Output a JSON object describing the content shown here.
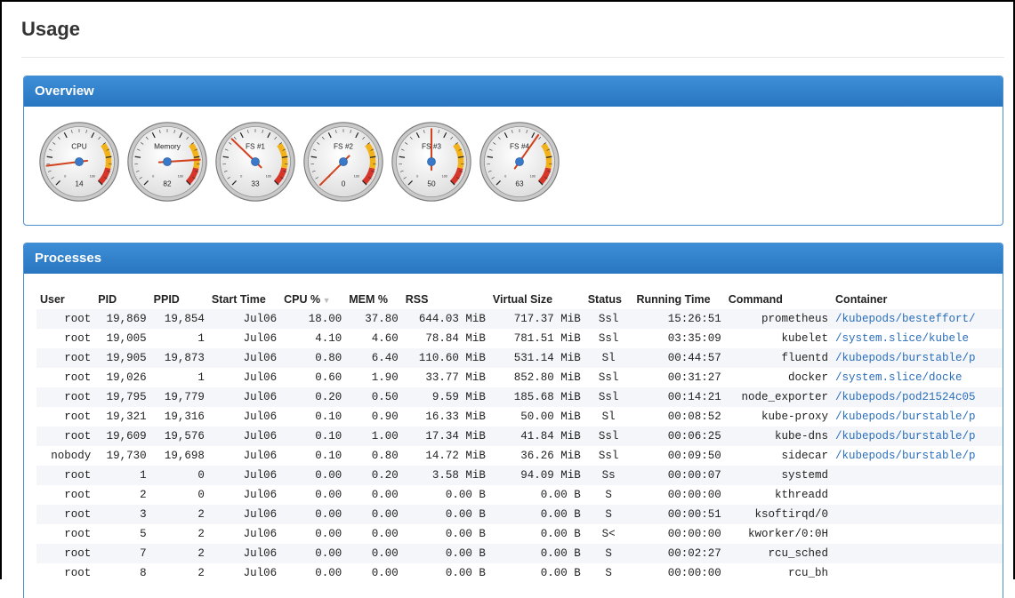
{
  "page": {
    "title": "Usage"
  },
  "overview": {
    "title": "Overview",
    "gauges": [
      {
        "label": "CPU",
        "value": 14
      },
      {
        "label": "Memory",
        "value": 82
      },
      {
        "label": "FS #1",
        "value": 33
      },
      {
        "label": "FS #2",
        "value": 0
      },
      {
        "label": "FS #3",
        "value": 50
      },
      {
        "label": "FS #4",
        "value": 63
      }
    ],
    "scale_min": "0",
    "scale_max": "100"
  },
  "processes": {
    "title": "Processes",
    "columns": [
      "User",
      "PID",
      "PPID",
      "Start Time",
      "CPU %",
      "MEM %",
      "RSS",
      "Virtual Size",
      "Status",
      "Running Time",
      "Command",
      "Container"
    ],
    "sort_indicator": "▼",
    "rows": [
      [
        "root",
        "19,869",
        "19,854",
        "Jul06",
        "18.00",
        "37.80",
        "644.03 MiB",
        "717.37 MiB",
        "Ssl",
        "15:26:51",
        "prometheus",
        "/kubepods/besteffort/"
      ],
      [
        "root",
        "19,005",
        "1",
        "Jul06",
        "4.10",
        "4.60",
        "78.84 MiB",
        "781.51 MiB",
        "Ssl",
        "03:35:09",
        "kubelet",
        "/system.slice/kubele"
      ],
      [
        "root",
        "19,905",
        "19,873",
        "Jul06",
        "0.80",
        "6.40",
        "110.60 MiB",
        "531.14 MiB",
        "Sl",
        "00:44:57",
        "fluentd",
        "/kubepods/burstable/p"
      ],
      [
        "root",
        "19,026",
        "1",
        "Jul06",
        "0.60",
        "1.90",
        "33.77 MiB",
        "852.80 MiB",
        "Ssl",
        "00:31:27",
        "docker",
        "/system.slice/docke"
      ],
      [
        "root",
        "19,795",
        "19,779",
        "Jul06",
        "0.20",
        "0.50",
        "9.59 MiB",
        "185.68 MiB",
        "Ssl",
        "00:14:21",
        "node_exporter",
        "/kubepods/pod21524c05"
      ],
      [
        "root",
        "19,321",
        "19,316",
        "Jul06",
        "0.10",
        "0.90",
        "16.33 MiB",
        "50.00 MiB",
        "Sl",
        "00:08:52",
        "kube-proxy",
        "/kubepods/burstable/p"
      ],
      [
        "root",
        "19,609",
        "19,576",
        "Jul06",
        "0.10",
        "1.00",
        "17.34 MiB",
        "41.84 MiB",
        "Ssl",
        "00:06:25",
        "kube-dns",
        "/kubepods/burstable/p"
      ],
      [
        "nobody",
        "19,730",
        "19,698",
        "Jul06",
        "0.10",
        "0.80",
        "14.72 MiB",
        "36.26 MiB",
        "Ssl",
        "00:09:50",
        "sidecar",
        "/kubepods/burstable/p"
      ],
      [
        "root",
        "1",
        "0",
        "Jul06",
        "0.00",
        "0.20",
        "3.58 MiB",
        "94.09 MiB",
        "Ss",
        "00:00:07",
        "systemd",
        ""
      ],
      [
        "root",
        "2",
        "0",
        "Jul06",
        "0.00",
        "0.00",
        "0.00 B",
        "0.00 B",
        "S",
        "00:00:00",
        "kthreadd",
        ""
      ],
      [
        "root",
        "3",
        "2",
        "Jul06",
        "0.00",
        "0.00",
        "0.00 B",
        "0.00 B",
        "S",
        "00:00:51",
        "ksoftirqd/0",
        ""
      ],
      [
        "root",
        "5",
        "2",
        "Jul06",
        "0.00",
        "0.00",
        "0.00 B",
        "0.00 B",
        "S<",
        "00:00:00",
        "kworker/0:0H",
        ""
      ],
      [
        "root",
        "7",
        "2",
        "Jul06",
        "0.00",
        "0.00",
        "0.00 B",
        "0.00 B",
        "S",
        "00:02:27",
        "rcu_sched",
        ""
      ],
      [
        "root",
        "8",
        "2",
        "Jul06",
        "0.00",
        "0.00",
        "0.00 B",
        "0.00 B",
        "S",
        "00:00:00",
        "rcu_bh",
        ""
      ]
    ]
  },
  "colors": {
    "panel_blue": "#2a76c0",
    "link": "#2a6ebb",
    "needle": "#d2421f",
    "hub": "#3a78c8"
  }
}
